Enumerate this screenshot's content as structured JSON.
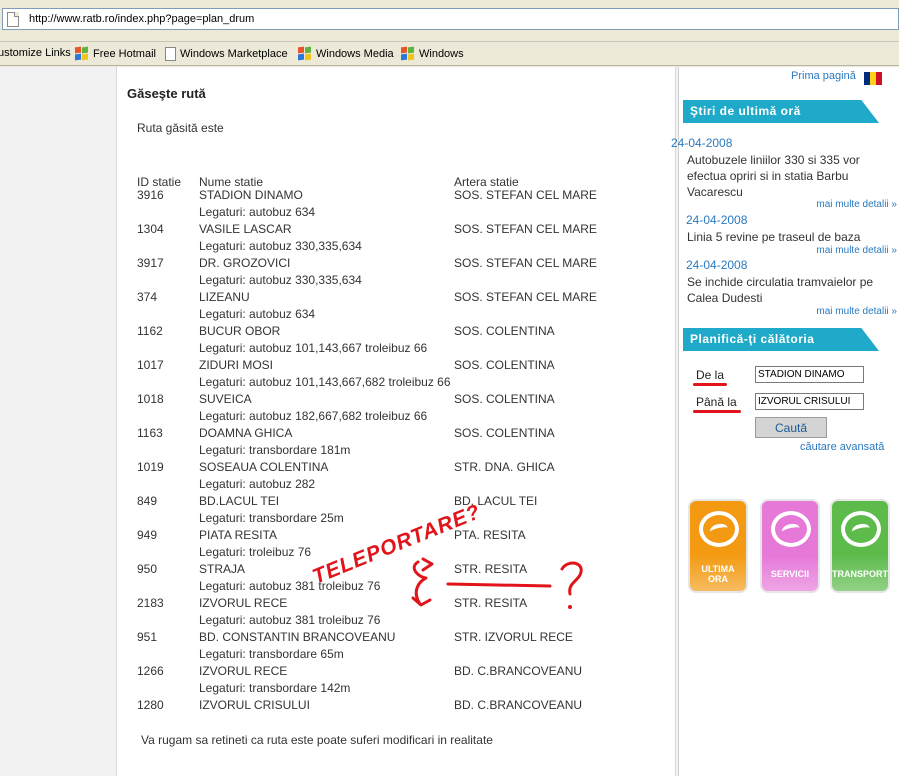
{
  "browser": {
    "url": "http://www.ratb.ro/index.php?page=plan_drum",
    "links": [
      "ustomize Links",
      "Free Hotmail",
      "Windows Marketplace",
      "Windows Media",
      "Windows"
    ]
  },
  "main": {
    "title": "Găseşte rută",
    "intro": "Ruta găsită este",
    "columns": [
      "ID statie",
      "Nume statie",
      "Artera statie"
    ],
    "rows": [
      {
        "id": "3916",
        "name": "STADION DINAMO",
        "link": "Legaturi: autobuz 634",
        "artery": "SOS. STEFAN CEL MARE"
      },
      {
        "id": "1304",
        "name": "VASILE LASCAR",
        "link": "Legaturi: autobuz 330,335,634",
        "artery": "SOS. STEFAN CEL MARE"
      },
      {
        "id": "3917",
        "name": "DR. GROZOVICI",
        "link": "Legaturi: autobuz 330,335,634",
        "artery": "SOS. STEFAN CEL MARE"
      },
      {
        "id": "374",
        "name": "LIZEANU",
        "link": "Legaturi: autobuz 634",
        "artery": "SOS. STEFAN CEL MARE"
      },
      {
        "id": "1162",
        "name": "BUCUR OBOR",
        "link": "Legaturi: autobuz 101,143,667 troleibuz 66",
        "artery": "SOS. COLENTINA"
      },
      {
        "id": "1017",
        "name": "ZIDURI MOSI",
        "link": "Legaturi: autobuz 101,143,667,682 troleibuz 66",
        "artery": "SOS. COLENTINA"
      },
      {
        "id": "1018",
        "name": "SUVEICA",
        "link": "Legaturi: autobuz 182,667,682 troleibuz 66",
        "artery": "SOS. COLENTINA"
      },
      {
        "id": "1163",
        "name": "DOAMNA GHICA",
        "link": "Legaturi: transbordare 181m",
        "artery": "SOS. COLENTINA"
      },
      {
        "id": "1019",
        "name": "SOSEAUA COLENTINA",
        "link": "Legaturi: autobuz 282",
        "artery": "STR. DNA. GHICA"
      },
      {
        "id": "849",
        "name": "BD.LACUL TEI",
        "link": "Legaturi: transbordare 25m",
        "artery": "BD. LACUL TEI"
      },
      {
        "id": "949",
        "name": "PIATA RESITA",
        "link": "Legaturi: troleibuz 76",
        "artery": "PTA. RESITA"
      },
      {
        "id": "950",
        "name": "STRAJA",
        "link": "Legaturi: autobuz 381 troleibuz 76",
        "artery": "STR. RESITA"
      },
      {
        "id": "2183",
        "name": "IZVORUL RECE",
        "link": "Legaturi: autobuz 381 troleibuz 76",
        "artery": "STR. RESITA"
      },
      {
        "id": "951",
        "name": "BD. CONSTANTIN BRANCOVEANU",
        "link": "Legaturi: transbordare 65m",
        "artery": "STR. IZVORUL RECE"
      },
      {
        "id": "1266",
        "name": "IZVORUL RECE",
        "link": "Legaturi: transbordare 142m",
        "artery": "BD. C.BRANCOVEANU"
      },
      {
        "id": "1280",
        "name": "IZVORUL CRISULUI",
        "link": "",
        "artery": "BD. C.BRANCOVEANU"
      }
    ],
    "note": "Va rugam sa retineti ca ruta este poate suferi modificari in realitate",
    "annotation": {
      "text": "TELEPORTARE?",
      "question": "?",
      "color": "#e0141a"
    }
  },
  "sidebar": {
    "home_link": "Prima pagină",
    "news_heading": "Ştiri de ultimă oră",
    "news": [
      {
        "date": "24-04-2008",
        "text": "Autobuzele liniilor 330 si 335 vor efectua opriri si in statia Barbu Vacarescu",
        "more": "mai multe detalii »"
      },
      {
        "date": "24-04-2008",
        "text": "Linia 5 revine pe traseul de baza",
        "more": "mai multe detalii »"
      },
      {
        "date": "24-04-2008",
        "text": "Se inchide circulatia tramvaielor pe Calea Dudesti",
        "more": "mai multe detalii »"
      }
    ],
    "planner_heading": "Planifică-ţi călătoria",
    "from_label": "De la",
    "from_value": "STADION DINAMO",
    "to_label": "Până la",
    "to_value": "IZVORUL CRISULUI",
    "search_label": "Caută",
    "advanced_link": "căutare avansată",
    "tiles": [
      {
        "line1": "ULTIMA",
        "line2": "ORA",
        "color": "#f39a12"
      },
      {
        "line1": "SERVICII",
        "line2": "",
        "color": "#e678d8"
      },
      {
        "line1": "TRANSPORT",
        "line2": "",
        "color": "#5dbb4c"
      }
    ],
    "accent_color": "#1eaac8",
    "flag_colors": [
      "#002b7f",
      "#fcd116",
      "#ce1126"
    ]
  }
}
